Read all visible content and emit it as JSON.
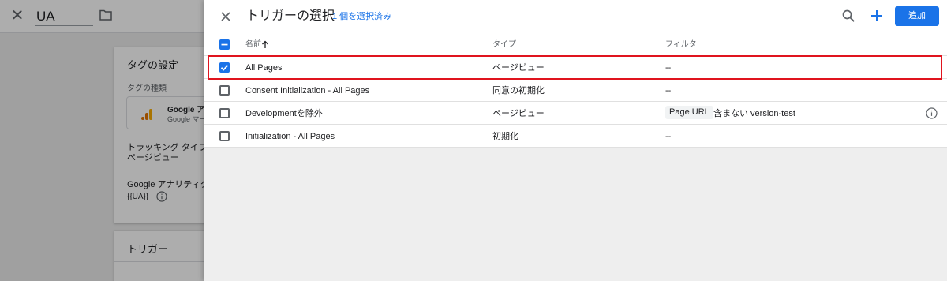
{
  "background_editor": {
    "tag_name": "UA",
    "tag_config_title": "タグの設定",
    "tag_type_label": "タグの種類",
    "tag_type_name": "Google ア",
    "tag_type_sub": "Google マー",
    "tracking_type_label": "トラッキング タイプ",
    "tracking_type_value": "ページビュー",
    "ga_settings_label": "Google アナリティク",
    "ga_variable": "{{UA}}",
    "triggers_title": "トリガー"
  },
  "panel": {
    "title": "トリガーの選択",
    "selected_count": "1 個を選択済み",
    "add_button": "追加"
  },
  "table": {
    "columns": [
      "名前",
      "タイプ",
      "フィルタ"
    ],
    "rows": [
      {
        "checked": true,
        "name": "All Pages",
        "type": "ページビュー",
        "filter": "--"
      },
      {
        "checked": false,
        "name": "Consent Initialization - All Pages",
        "type": "同意の初期化",
        "filter": "--"
      },
      {
        "checked": false,
        "name": "Developmentを除外",
        "type": "ページビュー",
        "filter_chip": "Page URL",
        "filter": "含まない version-test"
      },
      {
        "checked": false,
        "name": "Initialization - All Pages",
        "type": "初期化",
        "filter": "--"
      }
    ]
  },
  "colors": {
    "accent": "#1a73e8",
    "highlight": "#e0141e"
  }
}
